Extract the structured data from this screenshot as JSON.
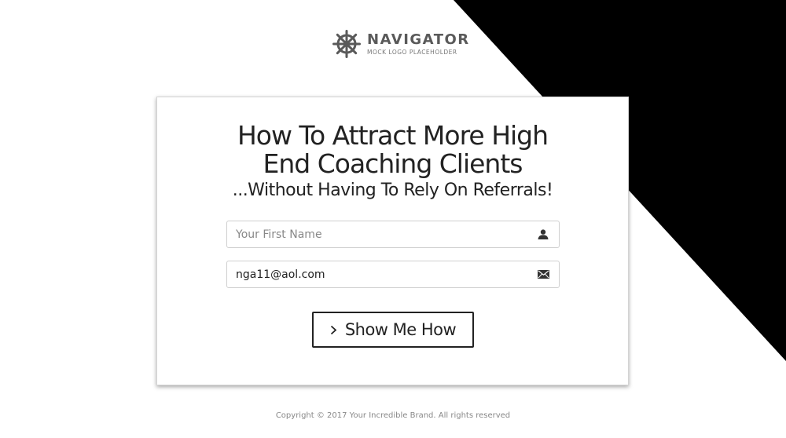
{
  "logo": {
    "name": "NAVIGATOR",
    "tagline": "MOCK LOGO PLACEHOLDER",
    "icon": "ship-wheel-icon"
  },
  "headline": {
    "line1": "How To Attract More High",
    "line2": "End Coaching Clients",
    "subheadline": "...Without Having To Rely On Referrals!"
  },
  "form": {
    "first_name": {
      "placeholder": "Your First Name",
      "value": "",
      "icon": "user-icon"
    },
    "email": {
      "placeholder": "",
      "value": "nga11@aol.com",
      "icon": "envelope-icon"
    },
    "submit_label": "Show Me How",
    "submit_icon": "chevron-right-icon"
  },
  "footer": {
    "copyright": "Copyright © 2017 Your Incredible Brand. All rights reserved"
  },
  "colors": {
    "background": "#ffffff",
    "diagonal": "#000000",
    "text": "#222222",
    "muted": "#888888"
  }
}
